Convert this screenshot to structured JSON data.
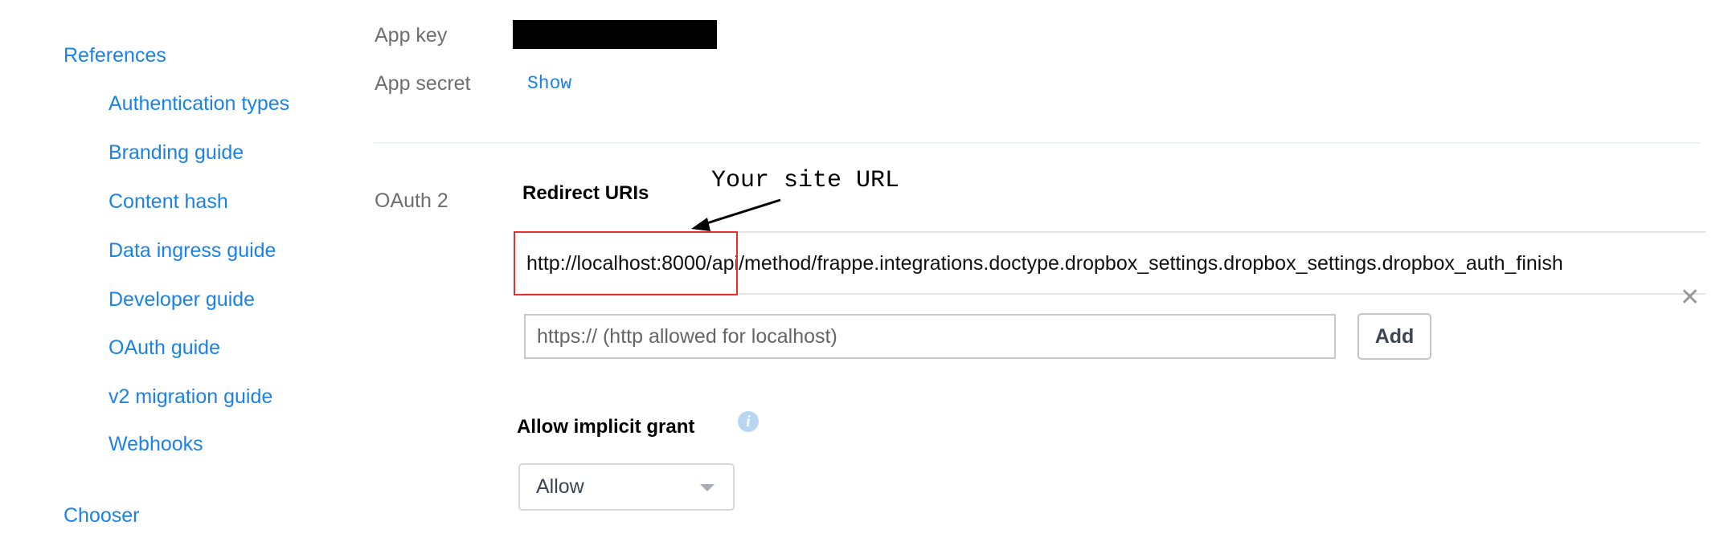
{
  "sidebar": {
    "section": "References",
    "items": [
      {
        "label": "Authentication types"
      },
      {
        "label": "Branding guide"
      },
      {
        "label": "Content hash"
      },
      {
        "label": "Data ingress guide"
      },
      {
        "label": "Developer guide"
      },
      {
        "label": "OAuth guide"
      },
      {
        "label": "v2 migration guide"
      },
      {
        "label": "Webhooks"
      }
    ],
    "next_section": "Chooser"
  },
  "app": {
    "app_key_label": "App key",
    "app_secret_label": "App secret",
    "show_label": "Show"
  },
  "oauth": {
    "label": "OAuth 2",
    "redirect_title": "Redirect URIs",
    "redirect_uri": "http://localhost:8000/api/method/frappe.integrations.doctype.dropbox_settings.dropbox_settings.dropbox_auth_finish",
    "remove_icon": "close-icon",
    "input_placeholder": "https:// (http allowed for localhost)",
    "add_label": "Add",
    "implicit_title": "Allow implicit grant",
    "info_icon": "info-icon",
    "implicit_value": "Allow"
  },
  "annotation": {
    "text": "Your site URL",
    "highlight_color": "#e8302a"
  },
  "colors": {
    "link": "#1a82e8"
  }
}
